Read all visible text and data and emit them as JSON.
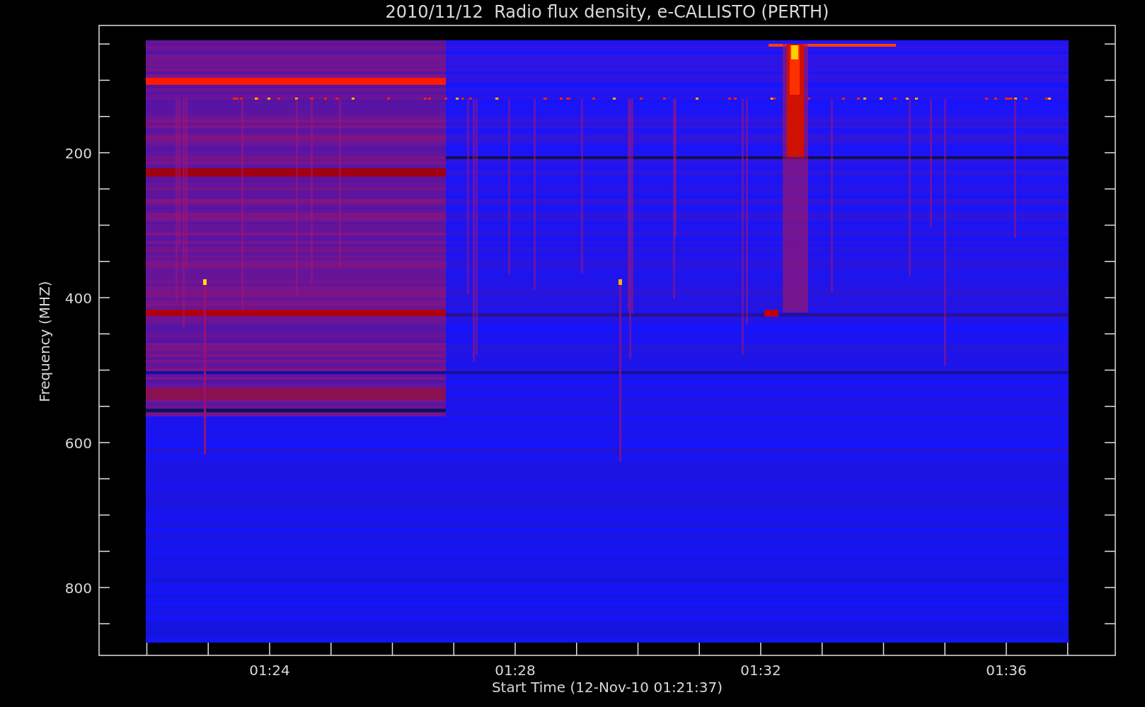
{
  "plot": {
    "title": "2010/11/12  Radio flux density, e-CALLISTO (PERTH)",
    "ylabel": "Frequency (MHZ)",
    "xlabel": "Start Time (12-Nov-10 01:21:37)",
    "yticks": [
      {
        "label": "200"
      },
      {
        "label": "400"
      },
      {
        "label": "600"
      },
      {
        "label": "800"
      }
    ],
    "xticks": [
      {
        "label": "01:24"
      },
      {
        "label": "01:28"
      },
      {
        "label": "01:32"
      },
      {
        "label": "01:36"
      }
    ]
  }
}
